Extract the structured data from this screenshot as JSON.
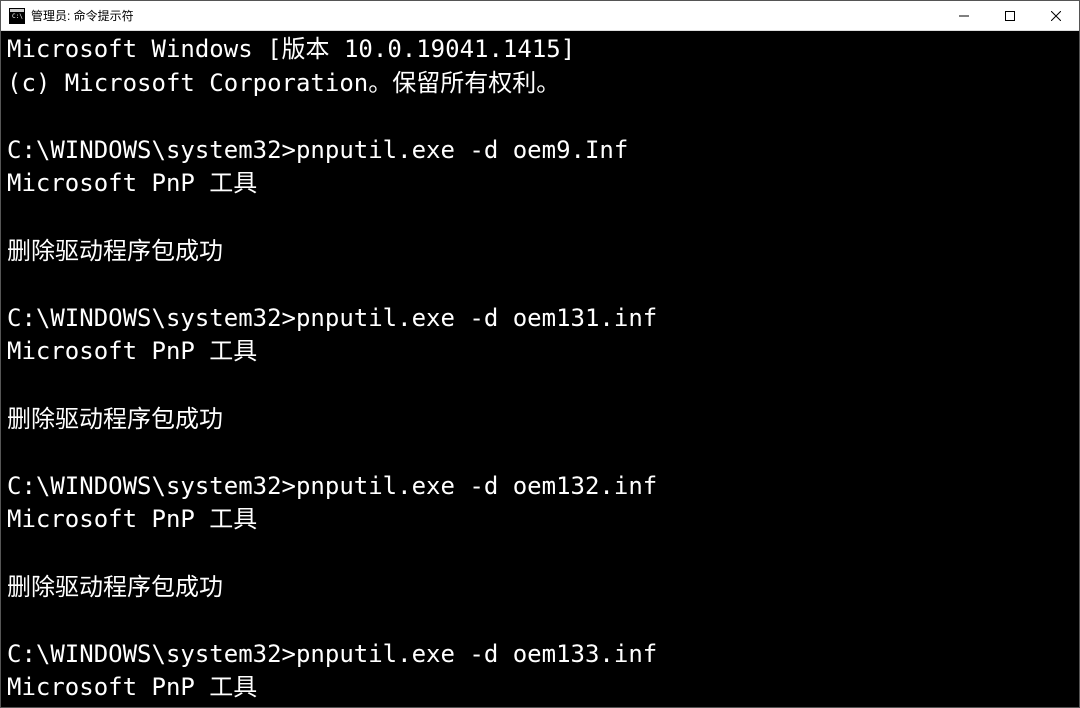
{
  "window": {
    "title": "管理员: 命令提示符"
  },
  "terminal": {
    "lines": [
      "Microsoft Windows [版本 10.0.19041.1415]",
      "(c) Microsoft Corporation。保留所有权利。",
      "",
      "C:\\WINDOWS\\system32>pnputil.exe -d oem9.Inf",
      "Microsoft PnP 工具",
      "",
      "删除驱动程序包成功",
      "",
      "C:\\WINDOWS\\system32>pnputil.exe -d oem131.inf",
      "Microsoft PnP 工具",
      "",
      "删除驱动程序包成功",
      "",
      "C:\\WINDOWS\\system32>pnputil.exe -d oem132.inf",
      "Microsoft PnP 工具",
      "",
      "删除驱动程序包成功",
      "",
      "C:\\WINDOWS\\system32>pnputil.exe -d oem133.inf",
      "Microsoft PnP 工具"
    ]
  }
}
